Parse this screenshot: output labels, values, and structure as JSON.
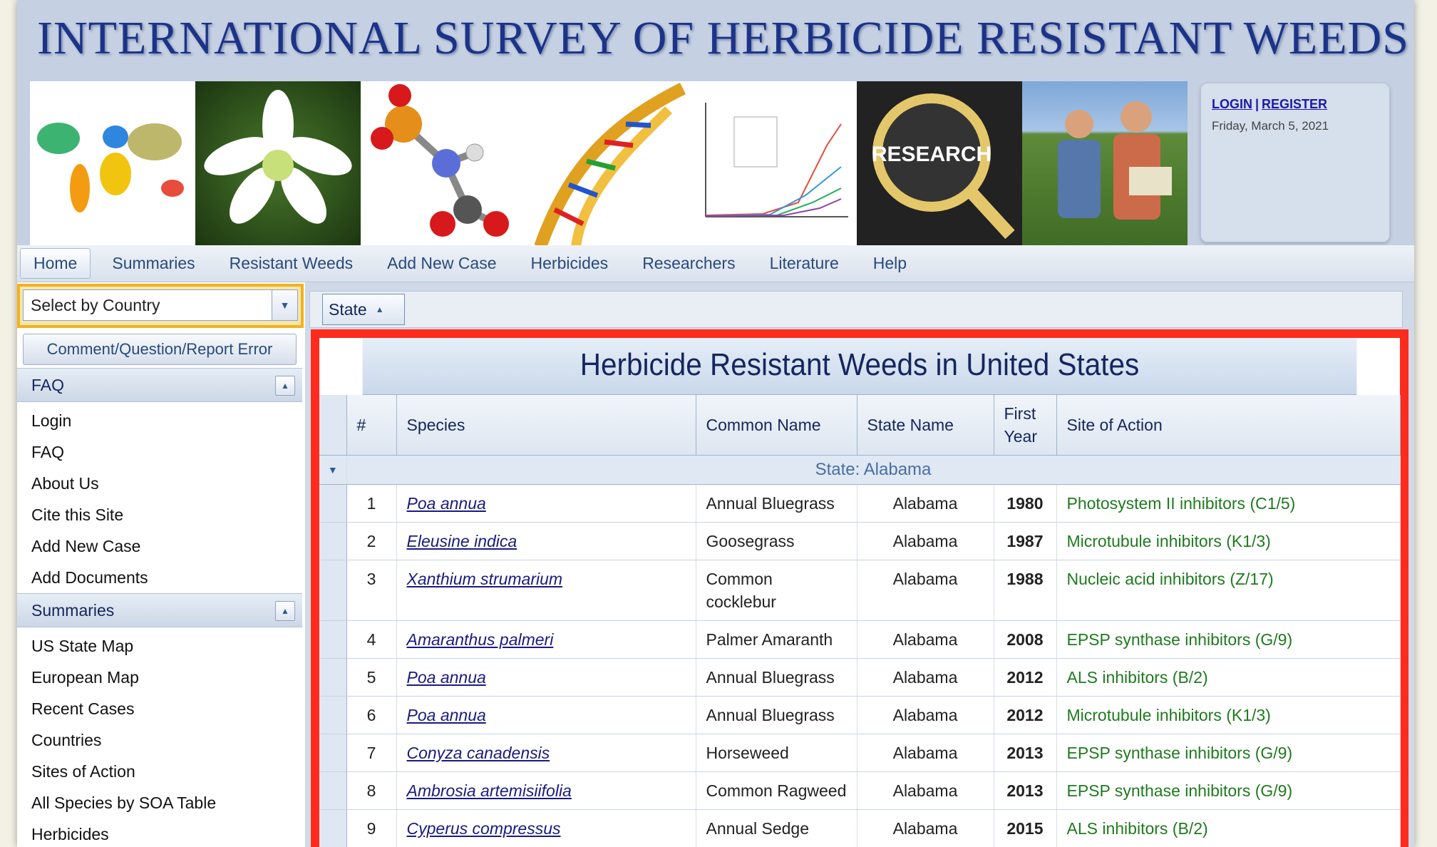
{
  "header": {
    "site_title": "INTERNATIONAL SURVEY OF HERBICIDE RESISTANT WEEDS",
    "banner_research_word": "RESEARCH",
    "login_label": "LOGIN",
    "register_label": "REGISTER",
    "separator": "|",
    "date": "Friday, March 5, 2021"
  },
  "nav": {
    "items": [
      "Home",
      "Summaries",
      "Resistant Weeds",
      "Add New Case",
      "Herbicides",
      "Researchers",
      "Literature",
      "Help"
    ]
  },
  "sidebar": {
    "country_select": "Select by Country",
    "report_button": "Comment/Question/Report Error",
    "faq_panel": {
      "title": "FAQ",
      "links": [
        "Login",
        "FAQ",
        "About Us",
        "Cite this Site",
        "Add New Case",
        "Add Documents"
      ]
    },
    "summaries_panel": {
      "title": "Summaries",
      "links": [
        "US State Map",
        "European Map",
        "Recent Cases",
        "Countries",
        "Sites of Action",
        "All Species by SOA Table",
        "Herbicides"
      ]
    }
  },
  "grid": {
    "group_chip": "State",
    "title": "Herbicide Resistant Weeds in United States",
    "columns": {
      "num": "#",
      "species": "Species",
      "common": "Common Name",
      "state": "State Name",
      "year_1": "First",
      "year_2": "Year",
      "soa": "Site of Action"
    },
    "group_label": "State: Alabama",
    "rows": [
      {
        "num": "1",
        "species": "Poa annua",
        "common": "Annual Bluegrass",
        "state": "Alabama",
        "year": "1980",
        "soa": "Photosystem II inhibitors (C1/5)"
      },
      {
        "num": "2",
        "species": "Eleusine indica",
        "common": "Goosegrass",
        "state": "Alabama",
        "year": "1987",
        "soa": "Microtubule inhibitors (K1/3)"
      },
      {
        "num": "3",
        "species": "Xanthium strumarium",
        "common": "Common cocklebur",
        "state": "Alabama",
        "year": "1988",
        "soa": "Nucleic acid inhibitors (Z/17)"
      },
      {
        "num": "4",
        "species": "Amaranthus palmeri",
        "common": "Palmer Amaranth",
        "state": "Alabama",
        "year": "2008",
        "soa": "EPSP synthase inhibitors (G/9)"
      },
      {
        "num": "5",
        "species": "Poa annua",
        "common": "Annual Bluegrass",
        "state": "Alabama",
        "year": "2012",
        "soa": "ALS inhibitors (B/2)"
      },
      {
        "num": "6",
        "species": "Poa annua",
        "common": "Annual Bluegrass",
        "state": "Alabama",
        "year": "2012",
        "soa": "Microtubule inhibitors (K1/3)"
      },
      {
        "num": "7",
        "species": "Conyza canadensis",
        "common": "Horseweed",
        "state": "Alabama",
        "year": "2013",
        "soa": "EPSP synthase inhibitors (G/9)"
      },
      {
        "num": "8",
        "species": "Ambrosia artemisiifolia",
        "common": "Common Ragweed",
        "state": "Alabama",
        "year": "2013",
        "soa": "EPSP synthase inhibitors (G/9)"
      },
      {
        "num": "9",
        "species": "Cyperus compressus",
        "common": "Annual Sedge",
        "state": "Alabama",
        "year": "2015",
        "soa": "ALS inhibitors (B/2)"
      }
    ]
  }
}
